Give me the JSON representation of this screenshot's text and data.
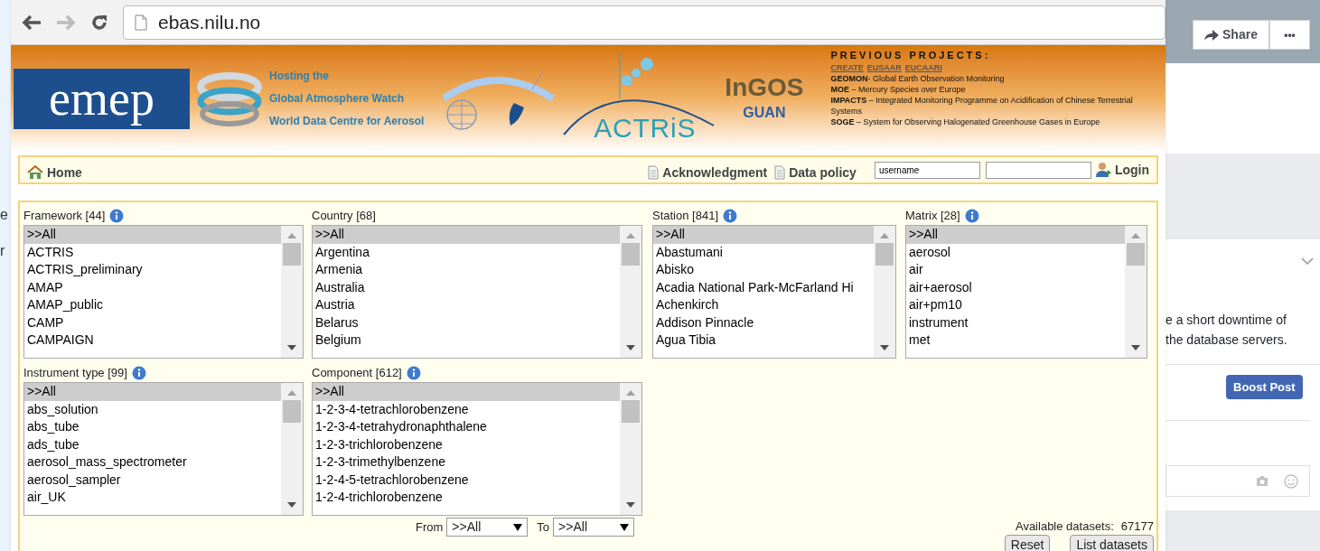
{
  "background_page": {
    "side_letters": [
      "e",
      "r"
    ],
    "share_button": "Share",
    "more_button": "•••",
    "post_text": [
      "e a short downtime of",
      "the database servers."
    ],
    "boost_button": "Boost Post"
  },
  "browser": {
    "url": "ebas.nilu.no"
  },
  "header": {
    "emep_logo": "emep",
    "gaw_lines": [
      "Hosting the",
      "Global Atmosphere Watch",
      "World Data Centre for Aerosol"
    ],
    "actris_logo": "ACTRiS",
    "ingos_logo": "InGOS",
    "guan_logo": "GUAN",
    "projects_title": "PREVIOUS PROJECTS:",
    "project_links": [
      "CREATE",
      "EUSAAR",
      "EUCAARI"
    ],
    "projects": [
      "**GEOMON**- Global Earth Observation Monitoring",
      "**MOE** – Mercury Species over Europe",
      "**IMPACTS** – Integrated Monitoring Programme on Acidification of Chinese Terrestrial Systems",
      "**SOGE** – System for Observing Halogenated Greenhouse Gases in Europe"
    ]
  },
  "nav": {
    "home": "Home",
    "acknowledgment": "Acknowledgment",
    "data_policy": "Data policy",
    "username_value": "username",
    "login": "Login"
  },
  "filters": [
    {
      "label": "Framework [44]",
      "info": true,
      "items": [
        {
          "text": ">>All",
          "selected": true
        },
        {
          "text": "ACTRIS",
          "selected": false
        },
        {
          "text": "ACTRIS_preliminary",
          "selected": false
        },
        {
          "text": "AMAP",
          "selected": false
        },
        {
          "text": "AMAP_public",
          "selected": false
        },
        {
          "text": "CAMP",
          "selected": false
        },
        {
          "text": "CAMPAIGN",
          "selected": false
        }
      ]
    },
    {
      "label": "Country [68]",
      "info": false,
      "items": [
        {
          "text": ">>All",
          "selected": true
        },
        {
          "text": "Argentina",
          "selected": false
        },
        {
          "text": "Armenia",
          "selected": false
        },
        {
          "text": "Australia",
          "selected": false
        },
        {
          "text": "Austria",
          "selected": false
        },
        {
          "text": "Belarus",
          "selected": false
        },
        {
          "text": "Belgium",
          "selected": false
        }
      ]
    },
    {
      "label": "Station [841]",
      "info": true,
      "items": [
        {
          "text": ">>All",
          "selected": true
        },
        {
          "text": "Abastumani",
          "selected": false
        },
        {
          "text": "Abisko",
          "selected": false
        },
        {
          "text": "Acadia National Park-McFarland Hi",
          "selected": false
        },
        {
          "text": "Achenkirch",
          "selected": false
        },
        {
          "text": "Addison Pinnacle",
          "selected": false
        },
        {
          "text": "Agua Tibia",
          "selected": false
        }
      ]
    },
    {
      "label": "Matrix [28]",
      "info": true,
      "items": [
        {
          "text": ">>All",
          "selected": true
        },
        {
          "text": "aerosol",
          "selected": false
        },
        {
          "text": "air",
          "selected": false
        },
        {
          "text": "air+aerosol",
          "selected": false
        },
        {
          "text": "air+pm10",
          "selected": false
        },
        {
          "text": "instrument",
          "selected": false
        },
        {
          "text": "met",
          "selected": false
        }
      ]
    },
    {
      "label": "Instrument type [99]",
      "info": true,
      "items": [
        {
          "text": ">>All",
          "selected": true
        },
        {
          "text": "abs_solution",
          "selected": false
        },
        {
          "text": "abs_tube",
          "selected": false
        },
        {
          "text": "ads_tube",
          "selected": false
        },
        {
          "text": "aerosol_mass_spectrometer",
          "selected": false
        },
        {
          "text": "aerosol_sampler",
          "selected": false
        },
        {
          "text": "air_UK",
          "selected": false
        }
      ]
    },
    {
      "label": "Component [612]",
      "info": true,
      "items": [
        {
          "text": ">>All",
          "selected": true
        },
        {
          "text": "1-2-3-4-tetrachlorobenzene",
          "selected": false
        },
        {
          "text": "1-2-3-4-tetrahydronaphthalene",
          "selected": false
        },
        {
          "text": "1-2-3-trichlorobenzene",
          "selected": false
        },
        {
          "text": "1-2-3-trimethylbenzene",
          "selected": false
        },
        {
          "text": "1-2-4-5-tetrachlorobenzene",
          "selected": false
        },
        {
          "text": "1-2-4-trichlorobenzene",
          "selected": false
        }
      ]
    }
  ],
  "period": {
    "from_label": "From",
    "from_value": ">>All",
    "to_label": "To",
    "to_value": ">>All"
  },
  "available": {
    "label": "Available datasets:",
    "count": "67177"
  },
  "buttons": [
    "Reset",
    "List datasets"
  ]
}
